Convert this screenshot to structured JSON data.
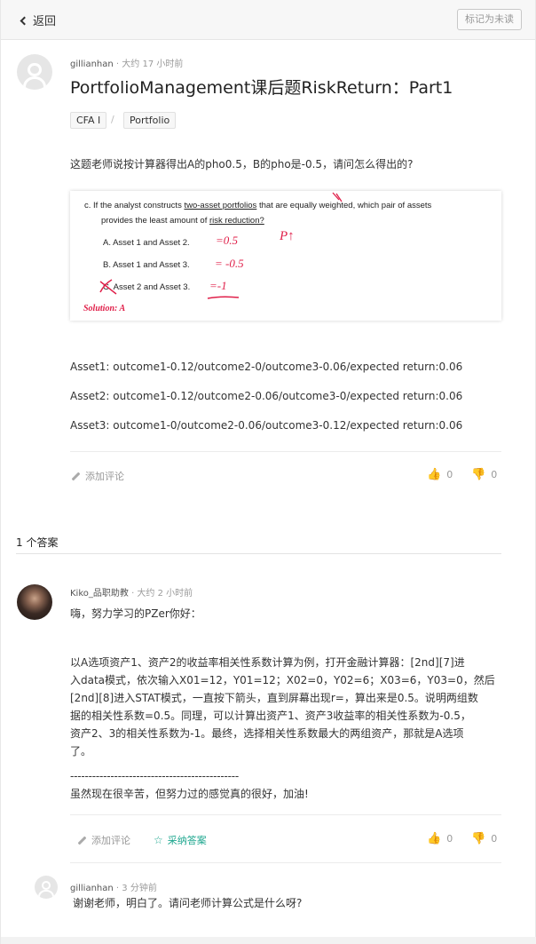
{
  "topbar": {
    "back_label": "返回",
    "mark_label": "标记为未读"
  },
  "question": {
    "author": "gillianhan",
    "time": "· 大约 17 小时前",
    "title": "PortfolioManagement课后题RiskReturn：Part1",
    "tags": [
      "CFA I",
      "Portfolio"
    ],
    "tag_separator": "/",
    "body": "这题老师说按计算器得出A的pho0.5，B的pho是-0.5，请问怎么得出的?",
    "image": {
      "line1_pre": "c.    If the analyst constructs ",
      "line1_u": "two-asset portfolios",
      "line1_post": " that are equally weighted, which pair of assets",
      "line2_pre": "provides the least amount of ",
      "line2_u": "risk reduction?",
      "optA": "A.    Asset 1 and Asset 2.",
      "optB": "B.    Asset 1 and Asset 3.",
      "optC": "C.    Asset 2 and Asset 3.",
      "handA": "=0.5",
      "handB": "= -0.5",
      "handC": "=-1",
      "handP": "P↑",
      "solution": "Solution: A"
    },
    "assets": [
      "Asset1: outcome1-0.12/outcome2-0/outcome3-0.06/expected return:0.06",
      "Asset2: outcome1-0.12/outcome2-0.06/outcome3-0/expected return:0.06",
      "Asset3: outcome1-0/outcome2-0.06/outcome3-0.12/expected return:0.06"
    ],
    "add_comment": "添加评论",
    "likes": "0",
    "dislikes": "0"
  },
  "answers_count_label": "1 个答案",
  "answer": {
    "author": "Kiko_品职助教",
    "time": "· 大约 2 小时前",
    "greeting": "嗨，努力学习的PZer你好：",
    "body_lines": [
      "以A选项资产1、资产2的收益率相关性系数计算为例，打开金融计算器：[2nd][7]进",
      "入data模式，依次输入X01=12，Y01=12；X02=0，Y02=6；X03=6，Y03=0，然后",
      "[2nd][8]进入STAT模式，一直按下箭头，直到屏幕出现r=，算出来是0.5。说明两组数",
      "据的相关性系数=0.5。同理，可以计算出资产1、资产3收益率的相关性系数为-0.5，",
      "资产2、3的相关性系数为-1。最终，选择相关性系数最大的两组资产，那就是A选项",
      "了。"
    ],
    "dash_line": "----------------------------------------------",
    "closing": "虽然现在很辛苦，但努力过的感觉真的很好，加油!",
    "add_comment": "添加评论",
    "accept": "采纳答案",
    "likes": "0",
    "dislikes": "0"
  },
  "reply": {
    "author": "gillianhan",
    "time": "· 3 分钟前",
    "body": "谢谢老师，明白了。请问老师计算公式是什么呀?"
  }
}
